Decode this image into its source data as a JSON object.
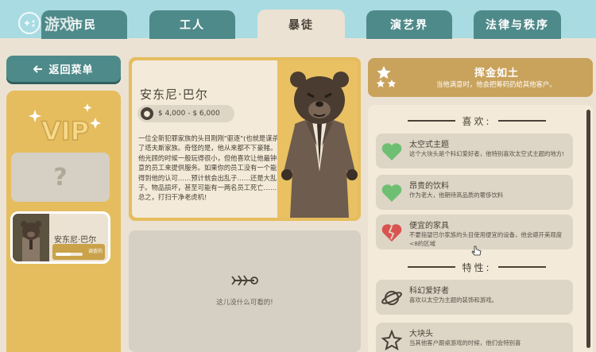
{
  "watermark": "游戏",
  "tabs": [
    {
      "label": "市民",
      "active": false
    },
    {
      "label": "工人",
      "active": false
    },
    {
      "label": "暴徒",
      "active": true
    },
    {
      "label": "演艺界",
      "active": false
    },
    {
      "label": "法律与秩序",
      "active": false
    }
  ],
  "back_button": {
    "label": "返回菜单",
    "icon": "arrow-left-icon"
  },
  "left_panel": {
    "vip_label": "VIP",
    "empty_slot_symbol": "?",
    "selected_slot": {
      "name": "安东尼·巴尔",
      "status_label": "调查的",
      "progress": 0.55
    }
  },
  "character": {
    "name": "安东尼·巴尔",
    "price": "$ 4,000 - $ 6,000",
    "description": "一位全新犯罪家族的头目刚刚\"驱逐\"(也就是谋杀)了塔夫斯家族。奇怪的是，他从来都不下豪赌。他光顾的时候一般玩得很小，但他喜欢让他最钟意的员工来提供服务。如果你的员工没有一个能得到他的认可……预计就会出乱子……还是大乱子。物品损坏，甚至可能有一两名员工死亡……总之，打扫干净老虎机!"
  },
  "empty_box": {
    "text": "这儿没什么可看的!"
  },
  "promo": {
    "title": "挥金如土",
    "subtitle": "当他满意时，他会把筹码扔给其他客户。"
  },
  "likes": {
    "header": "喜欢:",
    "items": [
      {
        "name": "太空式主题",
        "desc": "这个大块头是个科幻爱好者，他特别喜欢太空式主题的地方!",
        "icon": "heart-icon",
        "color": "#6fbf73"
      },
      {
        "name": "昂贵的饮料",
        "desc": "作为老大，他期待高品质的奢侈饮料",
        "icon": "heart-icon",
        "color": "#6fbf73"
      },
      {
        "name": "便宜的家具",
        "desc": "不要指望巴尔家族的头目使用便宜的设备，他会避开美观度<8的区域",
        "icon": "broken-heart-icon",
        "color": "#d9534f"
      }
    ]
  },
  "traits": {
    "header": "特性:",
    "items": [
      {
        "name": "科幻爱好者",
        "desc": "喜欢以太空为主题的装饰和游戏。",
        "icon": "planet-icon"
      },
      {
        "name": "大块头",
        "desc": "当其他客户跟桌游戏的时候，他们会特别喜",
        "icon": "star-burst-icon"
      }
    ]
  }
}
